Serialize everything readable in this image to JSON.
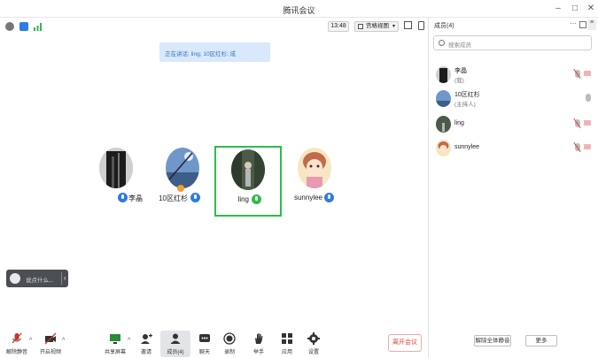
{
  "window": {
    "title": "腾讯会议"
  },
  "top_bar": {
    "time": "13:48",
    "view_label": "宫格视图"
  },
  "banner": {
    "text": "正在讲话: ling; 10区红杉; 成"
  },
  "participants": [
    {
      "name": "李晶",
      "mic": "blue"
    },
    {
      "name": "10区红杉",
      "mic": "blue"
    },
    {
      "name": "ling",
      "mic": "green"
    },
    {
      "name": "sunnylee",
      "mic": "blue"
    }
  ],
  "transcript": {
    "text": "说点什么..."
  },
  "toolbar": {
    "mute": "解除静音",
    "video": "开启视频",
    "share": "共享屏幕",
    "invite": "邀请",
    "members": "成员(4)",
    "chat": "聊天",
    "record": "录制",
    "raise_hand": "举手",
    "apps": "应用",
    "settings": "设置",
    "leave": "离开会议"
  },
  "panel": {
    "title": "成员(4)",
    "search_placeholder": "搜索成员",
    "members": [
      {
        "name": "李晶",
        "role": "(我)",
        "mic_muted": true,
        "cam_off": true
      },
      {
        "name": "10区红杉",
        "role": "(主持人)",
        "mic_muted": false,
        "cam_off": false
      },
      {
        "name": "ling",
        "role": "",
        "mic_muted": true,
        "cam_off": true
      },
      {
        "name": "sunnylee",
        "role": "",
        "mic_muted": true,
        "cam_off": true
      }
    ],
    "unmute_all": "解除全体静音",
    "more": "更多"
  },
  "colors": {
    "accent": "#2d7be5",
    "speaking": "#2fbb4c",
    "leave": "#e0453d"
  }
}
